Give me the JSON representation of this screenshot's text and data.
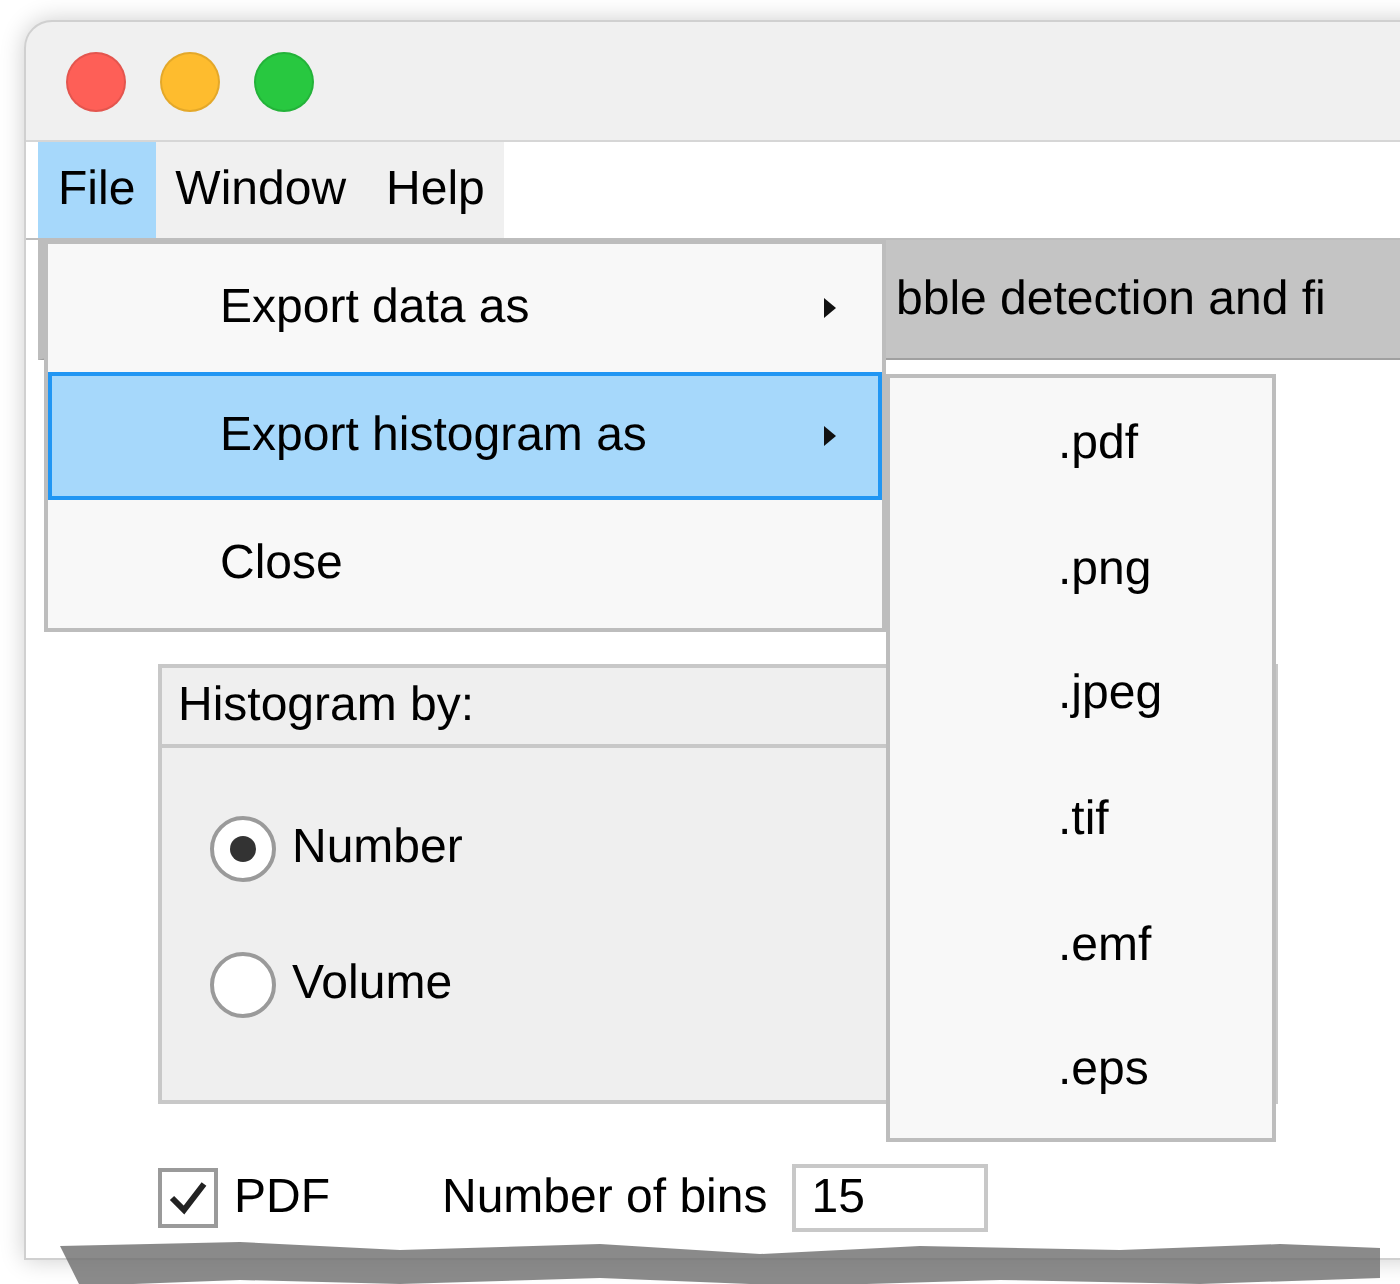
{
  "menu_bar": [
    {
      "label": "File",
      "selected": true
    },
    {
      "label": "Window",
      "selected": false
    },
    {
      "label": "Help",
      "selected": false
    }
  ],
  "tab": {
    "label": "bble detection and fi"
  },
  "file_menu": [
    {
      "label": "Export data as",
      "selected": false,
      "submenu": true
    },
    {
      "label": "Export histogram as",
      "selected": true,
      "submenu": true
    },
    {
      "label": "Close",
      "selected": false,
      "submenu": false
    }
  ],
  "submenu": [
    ".pdf",
    ".png",
    ".jpeg",
    ".tif",
    ".emf",
    ".eps"
  ],
  "histogram_group": {
    "title": "Histogram by:",
    "options": [
      {
        "label": "Number",
        "selected": true
      },
      {
        "label": "Volume",
        "selected": false
      }
    ]
  },
  "pdf": {
    "label": "PDF",
    "checked": true
  },
  "bins": {
    "label": "Number of bins",
    "value": "15"
  }
}
